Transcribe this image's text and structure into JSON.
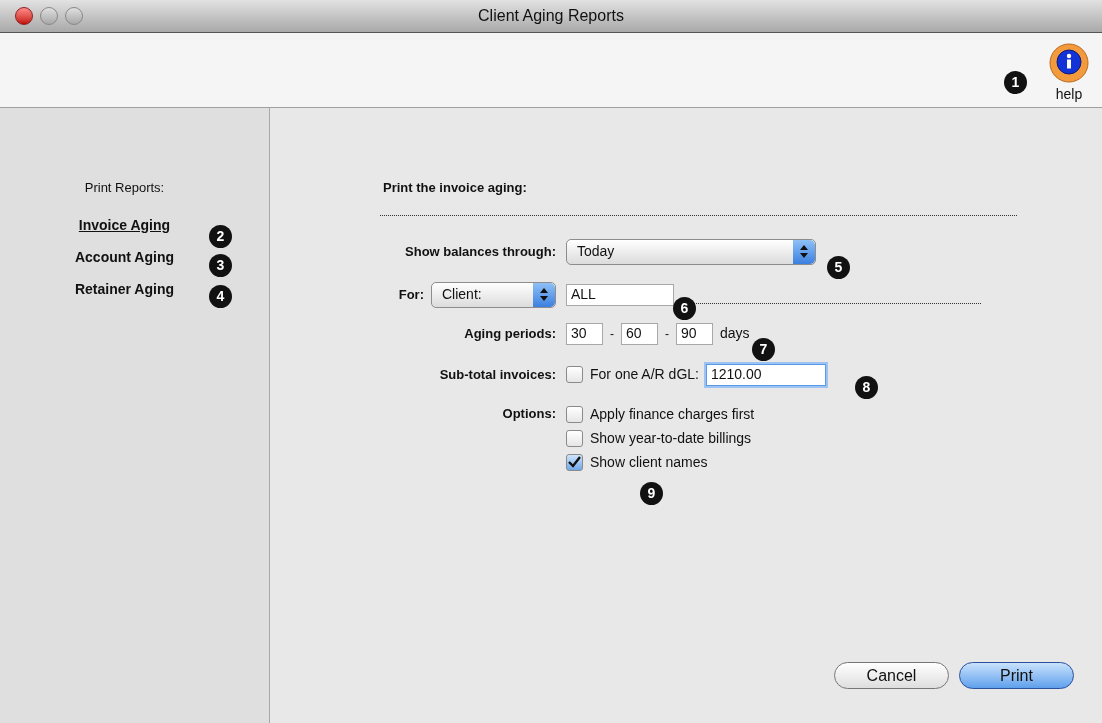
{
  "window": {
    "title": "Client Aging Reports"
  },
  "toolbar": {
    "help_label": "help"
  },
  "sidebar": {
    "heading": "Print Reports:",
    "items": [
      {
        "label": "Invoice Aging",
        "selected": true
      },
      {
        "label": "Account Aging",
        "selected": false
      },
      {
        "label": "Retainer Aging",
        "selected": false
      }
    ]
  },
  "main": {
    "heading": "Print the invoice aging:",
    "balances": {
      "label": "Show balances through:",
      "value": "Today"
    },
    "for": {
      "label": "For:",
      "popup": "Client:",
      "value": "ALL"
    },
    "aging": {
      "label": "Aging periods:",
      "periods": [
        "30",
        "60",
        "90"
      ],
      "separator": "-",
      "unit": "days"
    },
    "subtotal": {
      "label": "Sub-total invoices:",
      "checkbox_label": "For one A/R dGL:",
      "checked": false,
      "value": "1210.00"
    },
    "options": {
      "label": "Options:",
      "items": [
        {
          "label": "Apply finance charges first",
          "checked": false
        },
        {
          "label": "Show year-to-date billings",
          "checked": false
        },
        {
          "label": "Show client names",
          "checked": true
        }
      ]
    }
  },
  "buttons": [
    {
      "label": "Cancel",
      "default": false
    },
    {
      "label": "Print",
      "default": true
    }
  ],
  "callouts": [
    "1",
    "2",
    "3",
    "4",
    "5",
    "6",
    "7",
    "8",
    "9"
  ]
}
